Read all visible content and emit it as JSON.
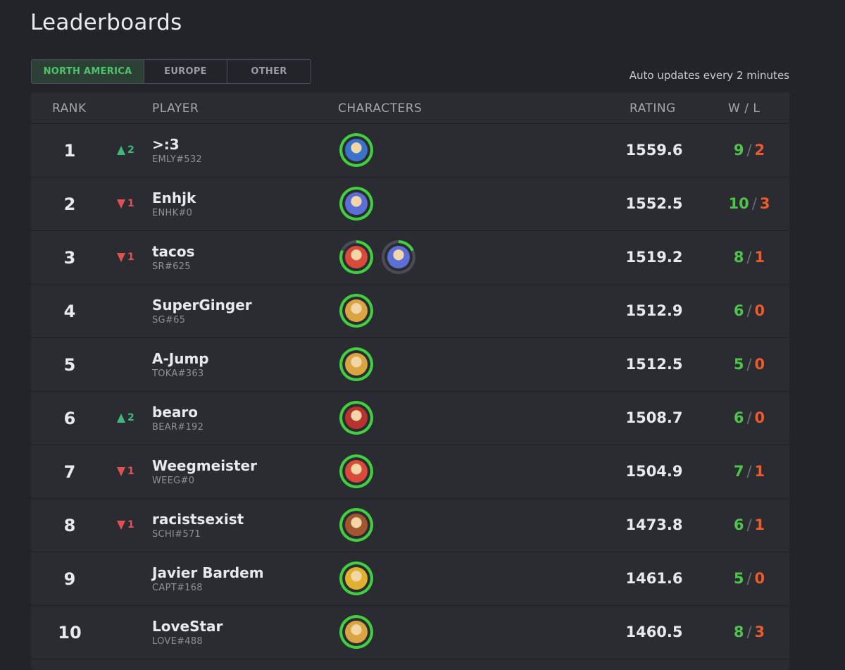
{
  "page": {
    "title": "Leaderboards"
  },
  "tabs": [
    {
      "label": "NORTH AMERICA",
      "active": true
    },
    {
      "label": "EUROPE",
      "active": false
    },
    {
      "label": "OTHER",
      "active": false
    }
  ],
  "auto_update_text": "Auto updates every 2 minutes",
  "columns": {
    "rank": "RANK",
    "player": "PLAYER",
    "characters": "CHARACTERS",
    "rating": "RATING",
    "wl": "W / L"
  },
  "colors": {
    "ring_green": "#3fcf3f",
    "win": "#4fc34a",
    "loss": "#ec5b2b",
    "up": "#3fb87a",
    "down": "#e05252"
  },
  "rows": [
    {
      "rank": "1",
      "change_dir": "up",
      "change": "2",
      "name": ">:3",
      "code": "EMLY#532",
      "characters": [
        {
          "icon": "marth-icon",
          "color": "#3a73c9",
          "pct": 1.0
        }
      ],
      "rating": "1559.6",
      "wins": "9",
      "losses": "2"
    },
    {
      "rank": "2",
      "change_dir": "down",
      "change": "1",
      "name": "Enhjk",
      "code": "ENHK#0",
      "characters": [
        {
          "icon": "falco-icon",
          "color": "#5b6fd6",
          "pct": 1.0
        }
      ],
      "rating": "1552.5",
      "wins": "10",
      "losses": "3"
    },
    {
      "rank": "3",
      "change_dir": "down",
      "change": "1",
      "name": "tacos",
      "code": "SR#625",
      "characters": [
        {
          "icon": "falcon-icon",
          "color": "#d94a3a",
          "pct": 0.82
        },
        {
          "icon": "falco-icon",
          "color": "#5b6fd6",
          "pct": 0.18
        }
      ],
      "rating": "1519.2",
      "wins": "8",
      "losses": "1"
    },
    {
      "rank": "4",
      "change_dir": "",
      "change": "",
      "name": "SuperGinger",
      "code": "SG#65",
      "characters": [
        {
          "icon": "fox-icon",
          "color": "#d9a441",
          "pct": 1.0
        }
      ],
      "rating": "1512.9",
      "wins": "6",
      "losses": "0"
    },
    {
      "rank": "5",
      "change_dir": "",
      "change": "",
      "name": "A-Jump",
      "code": "TOKA#363",
      "characters": [
        {
          "icon": "fox-icon",
          "color": "#d9a441",
          "pct": 1.0
        }
      ],
      "rating": "1512.5",
      "wins": "5",
      "losses": "0"
    },
    {
      "rank": "6",
      "change_dir": "up",
      "change": "2",
      "name": "bearo",
      "code": "BEAR#192",
      "characters": [
        {
          "icon": "roy-icon",
          "color": "#b8322e",
          "pct": 1.0
        }
      ],
      "rating": "1508.7",
      "wins": "6",
      "losses": "0"
    },
    {
      "rank": "7",
      "change_dir": "down",
      "change": "1",
      "name": "Weegmeister",
      "code": "WEEG#0",
      "characters": [
        {
          "icon": "falcon-icon",
          "color": "#d94a3a",
          "pct": 1.0
        }
      ],
      "rating": "1504.9",
      "wins": "7",
      "losses": "1"
    },
    {
      "rank": "8",
      "change_dir": "down",
      "change": "1",
      "name": "racistsexist",
      "code": "SCHI#571",
      "characters": [
        {
          "icon": "ganondorf-icon",
          "color": "#a1562f",
          "pct": 1.0
        }
      ],
      "rating": "1473.8",
      "wins": "6",
      "losses": "1"
    },
    {
      "rank": "9",
      "change_dir": "",
      "change": "",
      "name": "Javier Bardem",
      "code": "CAPT#168",
      "characters": [
        {
          "icon": "falcon-icon",
          "color": "#e0b12e",
          "pct": 1.0
        }
      ],
      "rating": "1461.6",
      "wins": "5",
      "losses": "0"
    },
    {
      "rank": "10",
      "change_dir": "",
      "change": "",
      "name": "LoveStar",
      "code": "LOVE#488",
      "characters": [
        {
          "icon": "fox-icon",
          "color": "#d9a441",
          "pct": 1.0
        }
      ],
      "rating": "1460.5",
      "wins": "8",
      "losses": "3"
    }
  ]
}
